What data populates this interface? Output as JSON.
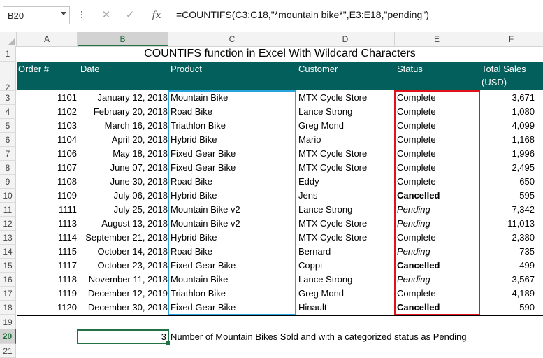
{
  "formula_bar": {
    "name_box": "B20",
    "cancel_icon": "✕",
    "enter_icon": "✓",
    "fx_label": "fx",
    "formula": "=COUNTIFS(C3:C18,\"*mountain bike*\",E3:E18,\"pending\")"
  },
  "columns": [
    "A",
    "B",
    "C",
    "D",
    "E",
    "F"
  ],
  "selected_column": "B",
  "rows": [
    "1",
    "2",
    "3",
    "4",
    "5",
    "6",
    "7",
    "8",
    "9",
    "10",
    "11",
    "12",
    "13",
    "14",
    "15",
    "16",
    "17",
    "18",
    "19",
    "20",
    "21"
  ],
  "selected_row": "20",
  "sheet": {
    "title": "COUNTIFS function in Excel With Wildcard Characters",
    "headers": {
      "order": "Order #",
      "date": "Date",
      "product": "Product",
      "customer": "Customer",
      "status": "Status",
      "total_sales_1": "Total Sales",
      "total_sales_2": "(USD)"
    },
    "records": [
      {
        "order": "1101",
        "date": "January 12, 2018",
        "product": "Mountain Bike",
        "customer": "MTX Cycle Store",
        "status": "Complete",
        "sales": "3,671",
        "style": "normal"
      },
      {
        "order": "1102",
        "date": "February 20, 2018",
        "product": "Road Bike",
        "customer": "Lance Strong",
        "status": "Complete",
        "sales": "1,080",
        "style": "normal"
      },
      {
        "order": "1103",
        "date": "March 16, 2018",
        "product": "Triathlon Bike",
        "customer": "Greg Mond",
        "status": "Complete",
        "sales": "4,099",
        "style": "normal"
      },
      {
        "order": "1104",
        "date": "April 20, 2018",
        "product": "Hybrid Bike",
        "customer": "Mario",
        "status": "Complete",
        "sales": "1,168",
        "style": "normal"
      },
      {
        "order": "1106",
        "date": "May 18, 2018",
        "product": "Fixed Gear Bike",
        "customer": "MTX Cycle Store",
        "status": "Complete",
        "sales": "1,996",
        "style": "normal"
      },
      {
        "order": "1107",
        "date": "June 07, 2018",
        "product": "Fixed Gear Bike",
        "customer": "MTX Cycle Store",
        "status": "Complete",
        "sales": "2,495",
        "style": "normal"
      },
      {
        "order": "1108",
        "date": "June 30, 2018",
        "product": "Road Bike",
        "customer": "Eddy",
        "status": "Complete",
        "sales": "650",
        "style": "normal"
      },
      {
        "order": "1109",
        "date": "July 06, 2018",
        "product": "Hybrid Bike",
        "customer": "Jens",
        "status": "Cancelled",
        "sales": "595",
        "style": "bold"
      },
      {
        "order": "1111",
        "date": "July 25, 2018",
        "product": "Mountain Bike v2",
        "customer": "Lance Strong",
        "status": "Pending",
        "sales": "7,342",
        "style": "italic"
      },
      {
        "order": "1113",
        "date": "August 13, 2018",
        "product": "Mountain Bike v2",
        "customer": "MTX Cycle Store",
        "status": "Pending",
        "sales": "11,013",
        "style": "italic"
      },
      {
        "order": "1114",
        "date": "September 21, 2018",
        "product": "Hybrid Bike",
        "customer": "MTX Cycle Store",
        "status": "Complete",
        "sales": "2,380",
        "style": "normal"
      },
      {
        "order": "1115",
        "date": "October 14, 2018",
        "product": "Road Bike",
        "customer": "Bernard",
        "status": "Pending",
        "sales": "735",
        "style": "italic"
      },
      {
        "order": "1117",
        "date": "October 23, 2018",
        "product": "Fixed Gear Bike",
        "customer": "Coppi",
        "status": "Cancelled",
        "sales": "499",
        "style": "bold"
      },
      {
        "order": "1118",
        "date": "November 11, 2018",
        "product": "Mountain Bike",
        "customer": "Lance Strong",
        "status": "Pending",
        "sales": "3,567",
        "style": "italic"
      },
      {
        "order": "1119",
        "date": "December 12, 2019",
        "product": "Triathlon Bike",
        "customer": "Greg Mond",
        "status": "Complete",
        "sales": "4,189",
        "style": "normal"
      },
      {
        "order": "1120",
        "date": "December 30, 2018",
        "product": "Fixed Gear Bike",
        "customer": "Hinault",
        "status": "Cancelled",
        "sales": "590",
        "style": "bold"
      }
    ],
    "result_value": "3",
    "result_label": "Number of Mountain Bikes Sold and with a categorized status as Pending"
  },
  "colors": {
    "header_band": "#035f5c",
    "product_highlight": "#29a3da",
    "status_highlight": "#e0131a",
    "active_cell": "#217346"
  }
}
